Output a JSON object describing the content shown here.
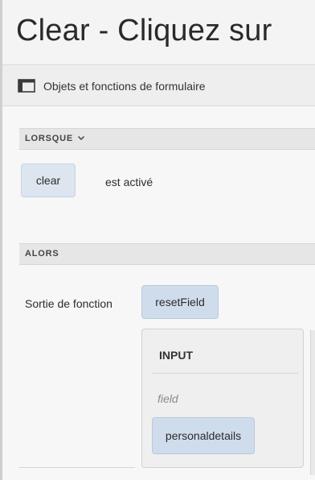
{
  "title": "Clear - Cliquez sur",
  "toolbar": {
    "label": "Objets et fonctions de formulaire",
    "icon": "form-objects-icon"
  },
  "when_section": {
    "label": "LORSQUE",
    "object": "clear",
    "event": "est activé"
  },
  "then_section": {
    "label": "ALORS",
    "action_label": "Sortie de fonction",
    "function": "resetField",
    "input_panel": {
      "heading": "INPUT",
      "param_name": "field",
      "param_value": "personaldetails"
    }
  },
  "colors": {
    "token_bg": "#dde6f0",
    "token_border": "#c6d3e3",
    "section_header_bg": "#e6e6e6"
  }
}
